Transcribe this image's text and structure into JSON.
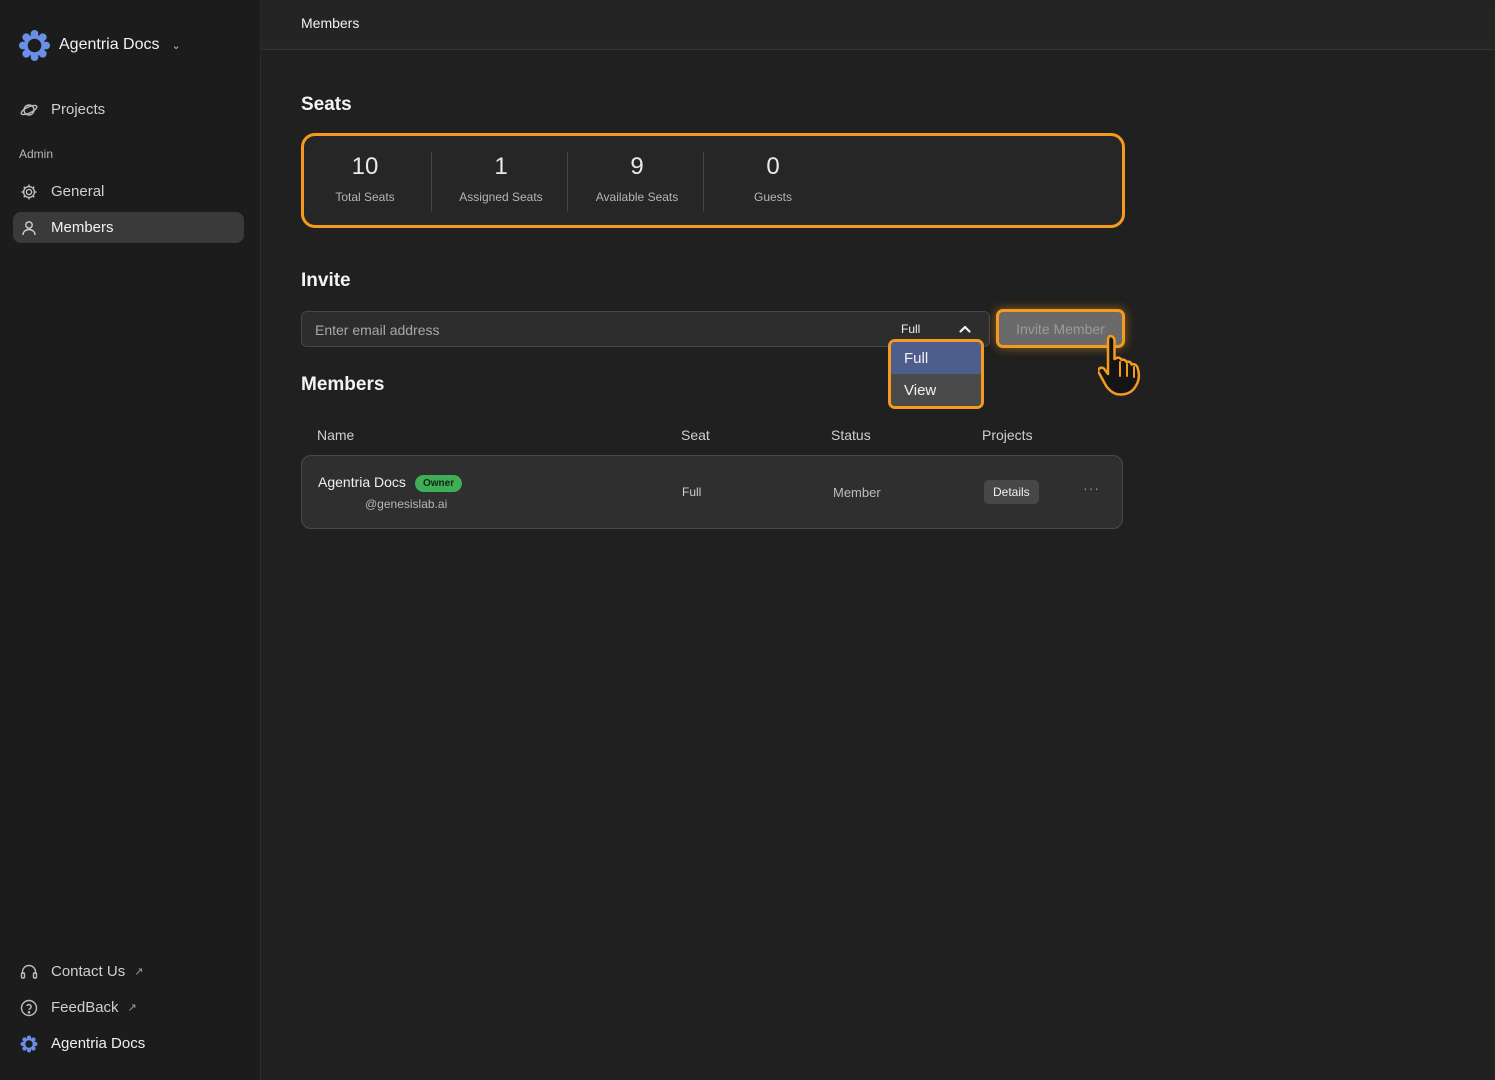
{
  "sidebar": {
    "brand": "Agentria Docs",
    "items": [
      {
        "label": "Projects"
      },
      {
        "label": "General"
      },
      {
        "label": "Members"
      }
    ],
    "section": "Admin",
    "footer": [
      {
        "label": "Contact Us"
      },
      {
        "label": "FeedBack"
      },
      {
        "label": "Agentria Docs"
      }
    ]
  },
  "topbar": {
    "title": "Members"
  },
  "seats": {
    "heading": "Seats",
    "stats": [
      {
        "value": "10",
        "label": "Total Seats"
      },
      {
        "value": "1",
        "label": "Assigned Seats"
      },
      {
        "value": "9",
        "label": "Available Seats"
      },
      {
        "value": "0",
        "label": "Guests"
      }
    ]
  },
  "invite": {
    "heading": "Invite",
    "placeholder": "Enter email address",
    "selected": "Full",
    "options": [
      "Full",
      "View"
    ],
    "button": "Invite Member"
  },
  "members": {
    "heading": "Members",
    "columns": [
      "Name",
      "Seat",
      "Status",
      "Projects"
    ],
    "rows": [
      {
        "name": "Agentria Docs",
        "badge": "Owner",
        "handle": "@genesislab.ai",
        "seat": "Full",
        "status": "Member",
        "projects": "Details",
        "more": "···"
      }
    ]
  },
  "colors": {
    "highlight": "#f39a1f",
    "badge": "#3fae57",
    "selected_option": "#4d5d8c"
  }
}
